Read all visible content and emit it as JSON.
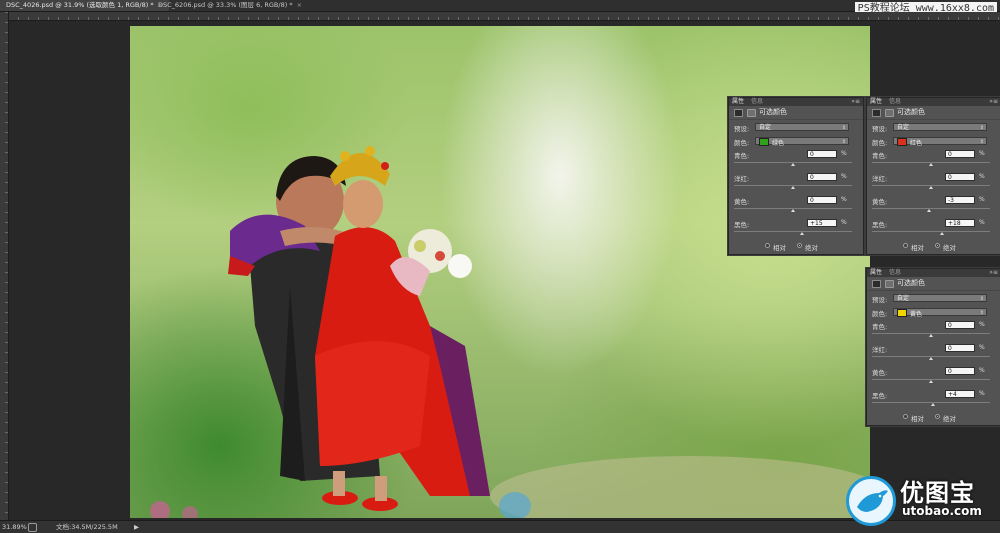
{
  "tabs": [
    {
      "label": "DSC_4026.psd @ 31.9% (选取颜色 1, RGB/8) *",
      "close": "×",
      "active": true
    },
    {
      "label": "DSC_6206.psd @ 33.3% (图层 6, RGB/8) *",
      "close": "×",
      "active": false
    }
  ],
  "watermark": "PS教程论坛 www.16xx8.com",
  "status": {
    "zoom": "31.89%",
    "doc": "文档:34.5M/225.5M",
    "arrow": "▶"
  },
  "panels": [
    {
      "tab_props": "属性",
      "tab_info": "信息",
      "menu": "»≡",
      "title": "可选颜色",
      "preset_label": "预设:",
      "preset_value": "自定",
      "colors_label": "颜色:",
      "color_value": "绿色",
      "swatch": "#2fa11a",
      "sliders": [
        {
          "label": "青色:",
          "value": "0",
          "unit": "%",
          "pos": 0.5
        },
        {
          "label": "洋红:",
          "value": "0",
          "unit": "%",
          "pos": 0.5
        },
        {
          "label": "黄色:",
          "value": "0",
          "unit": "%",
          "pos": 0.5
        },
        {
          "label": "黑色:",
          "value": "+15",
          "unit": "%",
          "pos": 0.575
        }
      ],
      "method_relative": "相对",
      "method_absolute": "绝对",
      "method_selected": "absolute"
    },
    {
      "tab_props": "属性",
      "tab_info": "信息",
      "menu": "»≡",
      "title": "可选颜色",
      "preset_label": "预设:",
      "preset_value": "自定",
      "colors_label": "颜色:",
      "color_value": "红色",
      "swatch": "#d8321e",
      "sliders": [
        {
          "label": "青色:",
          "value": "0",
          "unit": "%",
          "pos": 0.5
        },
        {
          "label": "洋红:",
          "value": "0",
          "unit": "%",
          "pos": 0.5
        },
        {
          "label": "黄色:",
          "value": "-3",
          "unit": "%",
          "pos": 0.485
        },
        {
          "label": "黑色:",
          "value": "+18",
          "unit": "%",
          "pos": 0.59
        }
      ],
      "method_relative": "相对",
      "method_absolute": "绝对",
      "method_selected": "absolute"
    },
    {
      "tab_props": "属性",
      "tab_info": "信息",
      "menu": "»≡",
      "title": "可选颜色",
      "preset_label": "预设:",
      "preset_value": "自定",
      "colors_label": "颜色:",
      "color_value": "黄色",
      "swatch": "#f2d400",
      "sliders": [
        {
          "label": "青色:",
          "value": "0",
          "unit": "%",
          "pos": 0.5
        },
        {
          "label": "洋红:",
          "value": "0",
          "unit": "%",
          "pos": 0.5
        },
        {
          "label": "黄色:",
          "value": "0",
          "unit": "%",
          "pos": 0.5
        },
        {
          "label": "黑色:",
          "value": "+4",
          "unit": "%",
          "pos": 0.52
        }
      ],
      "method_relative": "相对",
      "method_absolute": "绝对",
      "method_selected": "absolute"
    }
  ],
  "logo": {
    "cn": "优图宝",
    "en": "utobao.com"
  }
}
